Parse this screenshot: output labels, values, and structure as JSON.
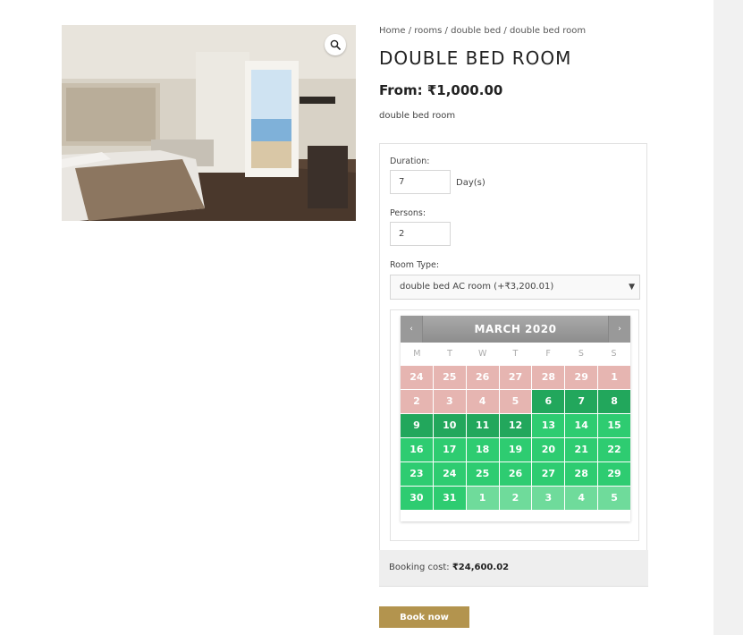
{
  "product": {
    "image_alt": "Hotel double bed room with balcony",
    "breadcrumb": [
      "Home",
      "rooms",
      "double bed",
      "double bed room"
    ],
    "breadcrumb_sep": " / ",
    "title": "DOUBLE BED ROOM",
    "price_prefix": "From:",
    "price": "₹1,000.00",
    "short_description": "double bed room"
  },
  "form": {
    "duration_label": "Duration:",
    "duration_value": "7",
    "duration_unit": "Day(s)",
    "persons_label": "Persons:",
    "persons_value": "2",
    "room_type_label": "Room Type:",
    "room_type_selected": "double bed AC room (+₹3,200.01)"
  },
  "calendar": {
    "title": "MARCH 2020",
    "prev": "‹",
    "next": "›",
    "weekdays": [
      "M",
      "T",
      "W",
      "T",
      "F",
      "S",
      "S"
    ],
    "days": [
      {
        "d": "24",
        "s": "past"
      },
      {
        "d": "25",
        "s": "past"
      },
      {
        "d": "26",
        "s": "past"
      },
      {
        "d": "27",
        "s": "past"
      },
      {
        "d": "28",
        "s": "past"
      },
      {
        "d": "29",
        "s": "past"
      },
      {
        "d": "1",
        "s": "past"
      },
      {
        "d": "2",
        "s": "past"
      },
      {
        "d": "3",
        "s": "past"
      },
      {
        "d": "4",
        "s": "past"
      },
      {
        "d": "5",
        "s": "past"
      },
      {
        "d": "6",
        "s": "selected"
      },
      {
        "d": "7",
        "s": "selected"
      },
      {
        "d": "8",
        "s": "selected"
      },
      {
        "d": "9",
        "s": "selected"
      },
      {
        "d": "10",
        "s": "selected"
      },
      {
        "d": "11",
        "s": "selected"
      },
      {
        "d": "12",
        "s": "selected"
      },
      {
        "d": "13",
        "s": "avail"
      },
      {
        "d": "14",
        "s": "avail"
      },
      {
        "d": "15",
        "s": "avail"
      },
      {
        "d": "16",
        "s": "avail"
      },
      {
        "d": "17",
        "s": "avail"
      },
      {
        "d": "18",
        "s": "avail"
      },
      {
        "d": "19",
        "s": "avail"
      },
      {
        "d": "20",
        "s": "avail"
      },
      {
        "d": "21",
        "s": "avail"
      },
      {
        "d": "22",
        "s": "avail"
      },
      {
        "d": "23",
        "s": "avail"
      },
      {
        "d": "24",
        "s": "avail"
      },
      {
        "d": "25",
        "s": "avail"
      },
      {
        "d": "26",
        "s": "avail"
      },
      {
        "d": "27",
        "s": "avail"
      },
      {
        "d": "28",
        "s": "avail"
      },
      {
        "d": "29",
        "s": "avail"
      },
      {
        "d": "30",
        "s": "avail"
      },
      {
        "d": "31",
        "s": "avail"
      },
      {
        "d": "1",
        "s": "next"
      },
      {
        "d": "2",
        "s": "next"
      },
      {
        "d": "3",
        "s": "next"
      },
      {
        "d": "4",
        "s": "next"
      },
      {
        "d": "5",
        "s": "next"
      }
    ]
  },
  "booking": {
    "cost_label": "Booking cost:",
    "cost_value": "₹24,600.02",
    "button_label": "Book now"
  },
  "colors": {
    "accent": "#b3944e",
    "past": "#e6b5b1",
    "available": "#2ecc71",
    "selected": "#22a75c",
    "next_month": "#6fdb9b"
  },
  "icons": {
    "zoom": "magnifier-icon",
    "select": "chevron-down-icon"
  }
}
